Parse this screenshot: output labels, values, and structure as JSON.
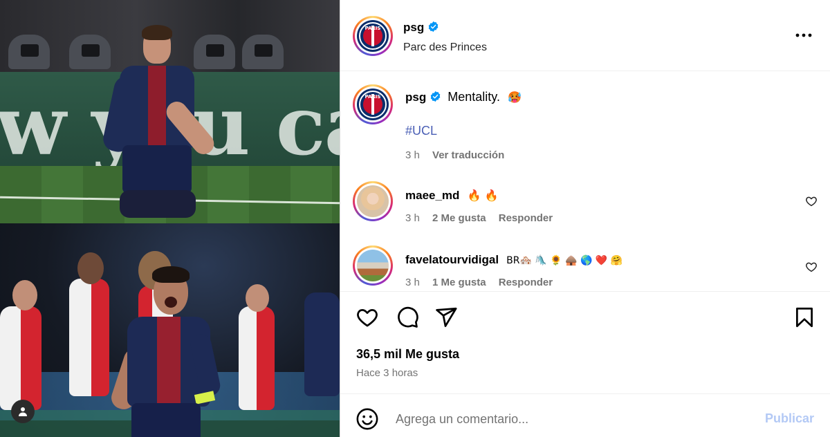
{
  "post": {
    "account": "psg",
    "location": "Parc des Princes",
    "caption": "Mentality.",
    "caption_emoji": "🥵",
    "hashtag": "#UCL",
    "caption_time": "3 h",
    "translate": "Ver traducción"
  },
  "comments": [
    {
      "user": "maee_md",
      "text": "🔥 🔥",
      "time": "3 h",
      "likes": "2 Me gusta",
      "reply": "Responder"
    },
    {
      "user": "favelatourvidigal",
      "text": "BR🏘️ 🛝 🌻 🛖 🌎 ❤️ 🤗",
      "time": "3 h",
      "likes": "1 Me gusta",
      "reply": "Responder"
    }
  ],
  "stats": {
    "likes": "36,5 mil Me gusta",
    "posted": "Hace 3 horas"
  },
  "composer": {
    "placeholder": "Agrega un comentario...",
    "submit": "Publicar"
  },
  "media": {
    "board_text": "w you ca"
  },
  "colors": {
    "verified": "#0095f6",
    "hashtag": "#4a5fb5",
    "muted": "#737373",
    "publish_disabled": "#b3c9f5"
  }
}
